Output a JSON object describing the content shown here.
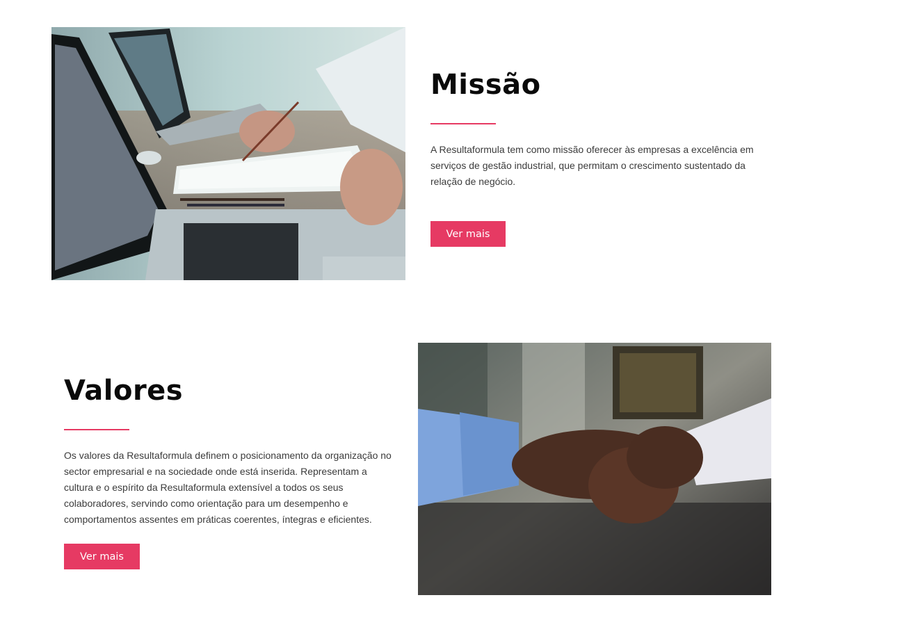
{
  "missao": {
    "title": "Missão",
    "text": "A Resultaformula tem como missão oferecer às empresas a excelência em serviços de gestão industrial, que permitam o crescimento sustentado da relação de negócio.",
    "button_label": "Ver mais"
  },
  "valores": {
    "title": "Valores",
    "text": "Os valores da Resultaformula definem o posicionamento da organização no sector empresarial e na sociedade onde está inserida. Representam a cultura e o espírito da Resultaformula extensível a todos os seus colaboradores, servindo como orientação para um desempenho e comportamentos assentes em práticas coerentes, íntegras e eficientes.",
    "button_label": "Ver mais"
  },
  "colors": {
    "accent": "#e63a63",
    "heading": "#0a0a0a",
    "body_text": "#3b3b3b"
  }
}
